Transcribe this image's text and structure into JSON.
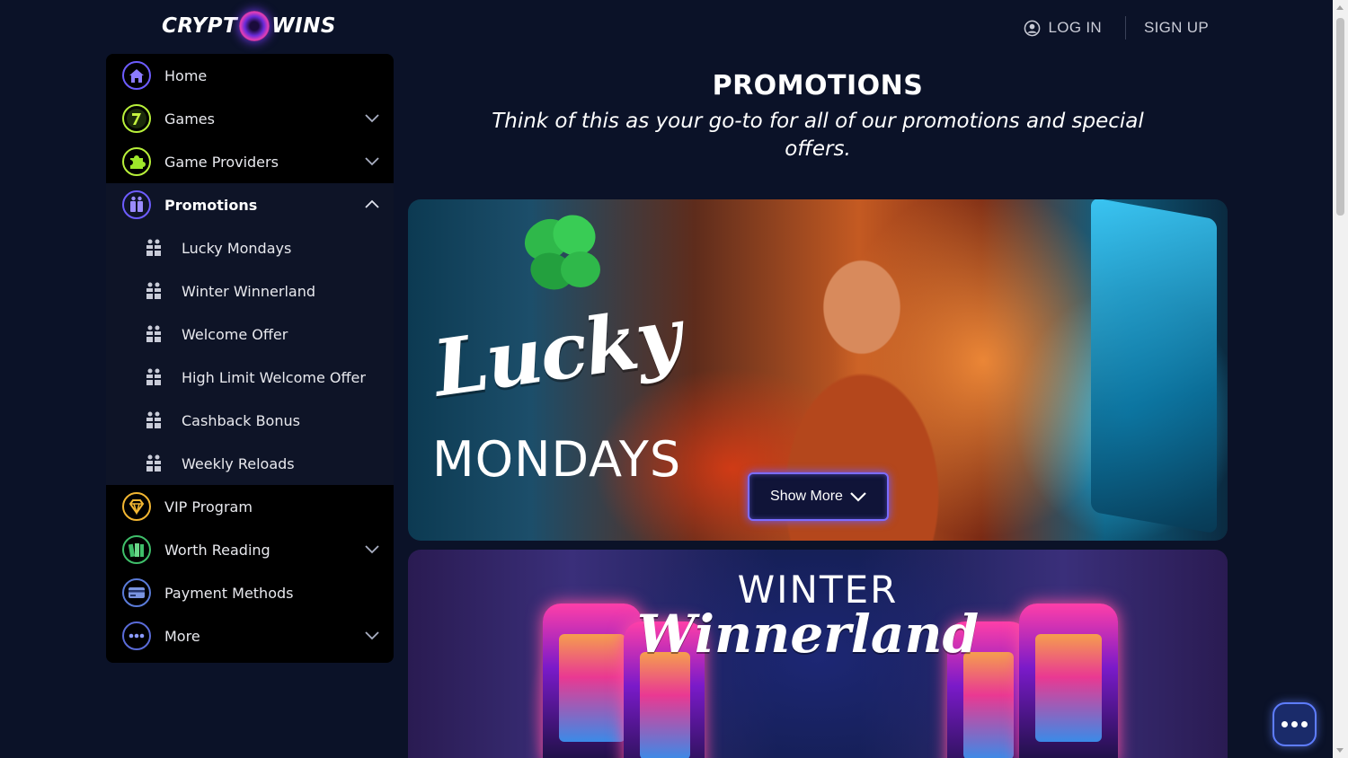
{
  "header": {
    "logo_left": "CRYPT",
    "logo_right": "WINS",
    "login_label": "LOG IN",
    "signup_label": "SIGN UP"
  },
  "sidebar": {
    "items": [
      {
        "label": "Home",
        "icon": "home-icon"
      },
      {
        "label": "Games",
        "icon": "seven-icon"
      },
      {
        "label": "Game Providers",
        "icon": "puzzle-icon"
      },
      {
        "label": "Promotions",
        "icon": "gift-icon"
      },
      {
        "label": "VIP Program",
        "icon": "diamond-icon"
      },
      {
        "label": "Worth Reading",
        "icon": "books-icon"
      },
      {
        "label": "Payment Methods",
        "icon": "credit-card-icon"
      },
      {
        "label": "More",
        "icon": "more-dots-icon"
      }
    ],
    "promotions_sub": [
      {
        "label": "Lucky Mondays"
      },
      {
        "label": "Winter Winnerland"
      },
      {
        "label": "Welcome Offer"
      },
      {
        "label": "High Limit Welcome Offer"
      },
      {
        "label": "Cashback Bonus"
      },
      {
        "label": "Weekly Reloads"
      }
    ]
  },
  "main": {
    "title": "PROMOTIONS",
    "subtitle": "Think of this as your go-to for all of our promotions and special offers.",
    "banners": [
      {
        "script": "Lucky",
        "caption": "MONDAYS",
        "button": "Show More"
      },
      {
        "caption": "WINTER",
        "script": "Winnerland"
      }
    ]
  },
  "colors": {
    "background": "#0b1228",
    "sidebar": "#000000",
    "accent": "#7c6cff"
  }
}
